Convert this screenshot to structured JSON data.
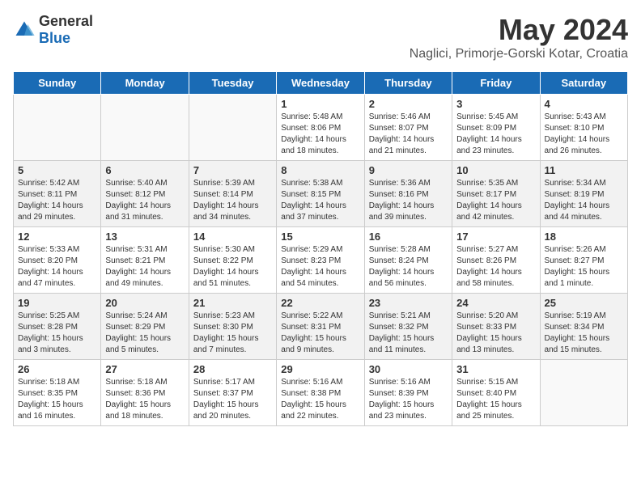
{
  "header": {
    "logo": {
      "general": "General",
      "blue": "Blue"
    },
    "title": "May 2024",
    "subtitle": "Naglici, Primorje-Gorski Kotar, Croatia"
  },
  "weekdays": [
    "Sunday",
    "Monday",
    "Tuesday",
    "Wednesday",
    "Thursday",
    "Friday",
    "Saturday"
  ],
  "weeks": [
    [
      {
        "day": "",
        "info": ""
      },
      {
        "day": "",
        "info": ""
      },
      {
        "day": "",
        "info": ""
      },
      {
        "day": "1",
        "info": "Sunrise: 5:48 AM\nSunset: 8:06 PM\nDaylight: 14 hours and 18 minutes."
      },
      {
        "day": "2",
        "info": "Sunrise: 5:46 AM\nSunset: 8:07 PM\nDaylight: 14 hours and 21 minutes."
      },
      {
        "day": "3",
        "info": "Sunrise: 5:45 AM\nSunset: 8:09 PM\nDaylight: 14 hours and 23 minutes."
      },
      {
        "day": "4",
        "info": "Sunrise: 5:43 AM\nSunset: 8:10 PM\nDaylight: 14 hours and 26 minutes."
      }
    ],
    [
      {
        "day": "5",
        "info": "Sunrise: 5:42 AM\nSunset: 8:11 PM\nDaylight: 14 hours and 29 minutes."
      },
      {
        "day": "6",
        "info": "Sunrise: 5:40 AM\nSunset: 8:12 PM\nDaylight: 14 hours and 31 minutes."
      },
      {
        "day": "7",
        "info": "Sunrise: 5:39 AM\nSunset: 8:14 PM\nDaylight: 14 hours and 34 minutes."
      },
      {
        "day": "8",
        "info": "Sunrise: 5:38 AM\nSunset: 8:15 PM\nDaylight: 14 hours and 37 minutes."
      },
      {
        "day": "9",
        "info": "Sunrise: 5:36 AM\nSunset: 8:16 PM\nDaylight: 14 hours and 39 minutes."
      },
      {
        "day": "10",
        "info": "Sunrise: 5:35 AM\nSunset: 8:17 PM\nDaylight: 14 hours and 42 minutes."
      },
      {
        "day": "11",
        "info": "Sunrise: 5:34 AM\nSunset: 8:19 PM\nDaylight: 14 hours and 44 minutes."
      }
    ],
    [
      {
        "day": "12",
        "info": "Sunrise: 5:33 AM\nSunset: 8:20 PM\nDaylight: 14 hours and 47 minutes."
      },
      {
        "day": "13",
        "info": "Sunrise: 5:31 AM\nSunset: 8:21 PM\nDaylight: 14 hours and 49 minutes."
      },
      {
        "day": "14",
        "info": "Sunrise: 5:30 AM\nSunset: 8:22 PM\nDaylight: 14 hours and 51 minutes."
      },
      {
        "day": "15",
        "info": "Sunrise: 5:29 AM\nSunset: 8:23 PM\nDaylight: 14 hours and 54 minutes."
      },
      {
        "day": "16",
        "info": "Sunrise: 5:28 AM\nSunset: 8:24 PM\nDaylight: 14 hours and 56 minutes."
      },
      {
        "day": "17",
        "info": "Sunrise: 5:27 AM\nSunset: 8:26 PM\nDaylight: 14 hours and 58 minutes."
      },
      {
        "day": "18",
        "info": "Sunrise: 5:26 AM\nSunset: 8:27 PM\nDaylight: 15 hours and 1 minute."
      }
    ],
    [
      {
        "day": "19",
        "info": "Sunrise: 5:25 AM\nSunset: 8:28 PM\nDaylight: 15 hours and 3 minutes."
      },
      {
        "day": "20",
        "info": "Sunrise: 5:24 AM\nSunset: 8:29 PM\nDaylight: 15 hours and 5 minutes."
      },
      {
        "day": "21",
        "info": "Sunrise: 5:23 AM\nSunset: 8:30 PM\nDaylight: 15 hours and 7 minutes."
      },
      {
        "day": "22",
        "info": "Sunrise: 5:22 AM\nSunset: 8:31 PM\nDaylight: 15 hours and 9 minutes."
      },
      {
        "day": "23",
        "info": "Sunrise: 5:21 AM\nSunset: 8:32 PM\nDaylight: 15 hours and 11 minutes."
      },
      {
        "day": "24",
        "info": "Sunrise: 5:20 AM\nSunset: 8:33 PM\nDaylight: 15 hours and 13 minutes."
      },
      {
        "day": "25",
        "info": "Sunrise: 5:19 AM\nSunset: 8:34 PM\nDaylight: 15 hours and 15 minutes."
      }
    ],
    [
      {
        "day": "26",
        "info": "Sunrise: 5:18 AM\nSunset: 8:35 PM\nDaylight: 15 hours and 16 minutes."
      },
      {
        "day": "27",
        "info": "Sunrise: 5:18 AM\nSunset: 8:36 PM\nDaylight: 15 hours and 18 minutes."
      },
      {
        "day": "28",
        "info": "Sunrise: 5:17 AM\nSunset: 8:37 PM\nDaylight: 15 hours and 20 minutes."
      },
      {
        "day": "29",
        "info": "Sunrise: 5:16 AM\nSunset: 8:38 PM\nDaylight: 15 hours and 22 minutes."
      },
      {
        "day": "30",
        "info": "Sunrise: 5:16 AM\nSunset: 8:39 PM\nDaylight: 15 hours and 23 minutes."
      },
      {
        "day": "31",
        "info": "Sunrise: 5:15 AM\nSunset: 8:40 PM\nDaylight: 15 hours and 25 minutes."
      },
      {
        "day": "",
        "info": ""
      }
    ]
  ]
}
